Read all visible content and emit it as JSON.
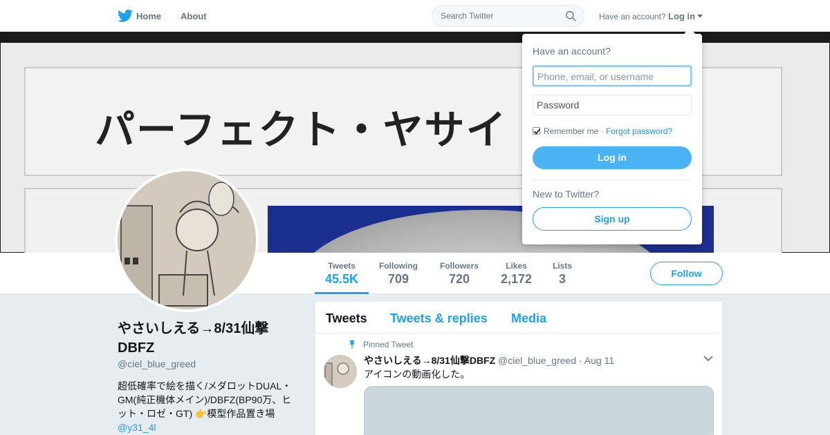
{
  "nav": {
    "home_label": "Home",
    "about_label": "About",
    "search_placeholder": "Search Twitter",
    "have_account": "Have an account?",
    "login_label": "Log in"
  },
  "icons": {
    "logo": "twitter-bird-icon",
    "search": "search-icon",
    "caret": "caret-down-icon",
    "pin": "pin-icon",
    "tweet_menu": "chevron-down-icon"
  },
  "colors": {
    "accent": "#1da1f2",
    "login_button": "#4ab3f4",
    "background": "#e6ecf0"
  },
  "banner": {
    "text": "パーフェクト・ヤサイ"
  },
  "profile_nav": {
    "stats": [
      {
        "label": "Tweets",
        "value": "45.5K",
        "active": true
      },
      {
        "label": "Following",
        "value": "709"
      },
      {
        "label": "Followers",
        "value": "720"
      },
      {
        "label": "Likes",
        "value": "2,172"
      },
      {
        "label": "Lists",
        "value": "3"
      }
    ],
    "follow_label": "Follow"
  },
  "profile": {
    "name": "やさいしえる→8/31仙撃DBFZ",
    "handle": "@ciel_blue_greed",
    "bio": "超低確率で絵を描く/メダロットDUAL・GM(純正機体メイン)/DBFZ(BP90万、ヒット・ロゼ・GT) 👉模型作品置き場",
    "bio_link": "@y31_4l"
  },
  "timeline": {
    "tabs": [
      "Tweets",
      "Tweets & replies",
      "Media"
    ],
    "pinned_label": "Pinned Tweet",
    "tweet": {
      "name": "やさいしえる→8/31仙撃DBFZ",
      "handle": "@ciel_blue_greed",
      "date": "· Aug 11",
      "text": "アイコンの動画化した。"
    }
  },
  "login_dropdown": {
    "title": "Have an account?",
    "username_placeholder": "Phone, email, or username",
    "password_placeholder": "Password",
    "remember_label": "Remember me ·",
    "forgot_label": "Forgot password?",
    "login_button": "Log in",
    "new_label": "New to Twitter?",
    "signup_button": "Sign up"
  }
}
